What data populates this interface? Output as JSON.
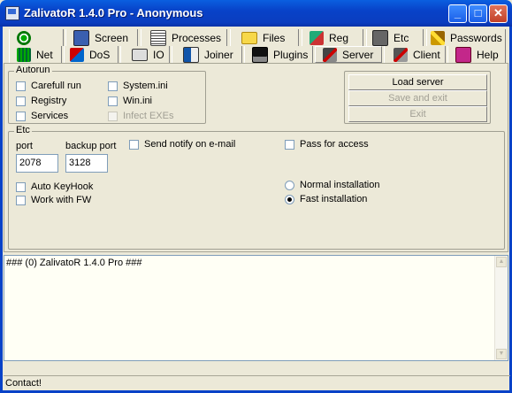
{
  "window": {
    "title": "ZalivatoR 1.4.0 Pro - Anonymous",
    "minimize": "_",
    "maximize": "□",
    "close": "✕"
  },
  "tabs_row1": [
    {
      "label": "",
      "icon": "target-icon"
    },
    {
      "label": "Screen",
      "icon": "screen-icon"
    },
    {
      "label": "Processes",
      "icon": "processes-icon"
    },
    {
      "label": "Files",
      "icon": "folder-icon"
    },
    {
      "label": "Reg",
      "icon": "registry-icon"
    },
    {
      "label": "Etc",
      "icon": "etc-icon"
    },
    {
      "label": "Passwords",
      "icon": "keys-icon"
    }
  ],
  "tabs_row2": [
    {
      "label": "Net",
      "icon": "net-icon"
    },
    {
      "label": "DoS",
      "icon": "dos-icon"
    },
    {
      "label": "IO",
      "icon": "printer-icon"
    },
    {
      "label": "Joiner",
      "icon": "joiner-icon"
    },
    {
      "label": "Plugins",
      "icon": "save-icon"
    },
    {
      "label": "Server",
      "icon": "server-icon",
      "active": true
    },
    {
      "label": "Client",
      "icon": "client-icon"
    },
    {
      "label": "Help",
      "icon": "book-icon"
    }
  ],
  "autorun": {
    "title": "Autorun",
    "carefull_run": "Carefull run",
    "registry": "Registry",
    "services": "Services",
    "system_ini": "System.ini",
    "win_ini": "Win.ini",
    "infect_exes": "Infect EXEs"
  },
  "buttons": {
    "load_server": "Load server",
    "save_and_exit": "Save and exit",
    "exit": "Exit"
  },
  "etc": {
    "title": "Etc",
    "port_label": "port",
    "port_value": "2078",
    "backup_port_label": "backup port",
    "backup_port_value": "3128",
    "send_notify": "Send notify on e-mail",
    "pass_for_access": "Pass for access",
    "auto_keyhook": "Auto KeyHook",
    "work_with_fw": "Work with FW",
    "normal_installation": "Normal installation",
    "fast_installation": "Fast installation"
  },
  "log": {
    "line": "### (0) ZalivatoR 1.4.0 Pro ###"
  },
  "status": {
    "text": "Contact!"
  },
  "colors": {
    "titlebar": "#0842c8",
    "face": "#ece9d8",
    "memo_bg": "#fffff5"
  }
}
